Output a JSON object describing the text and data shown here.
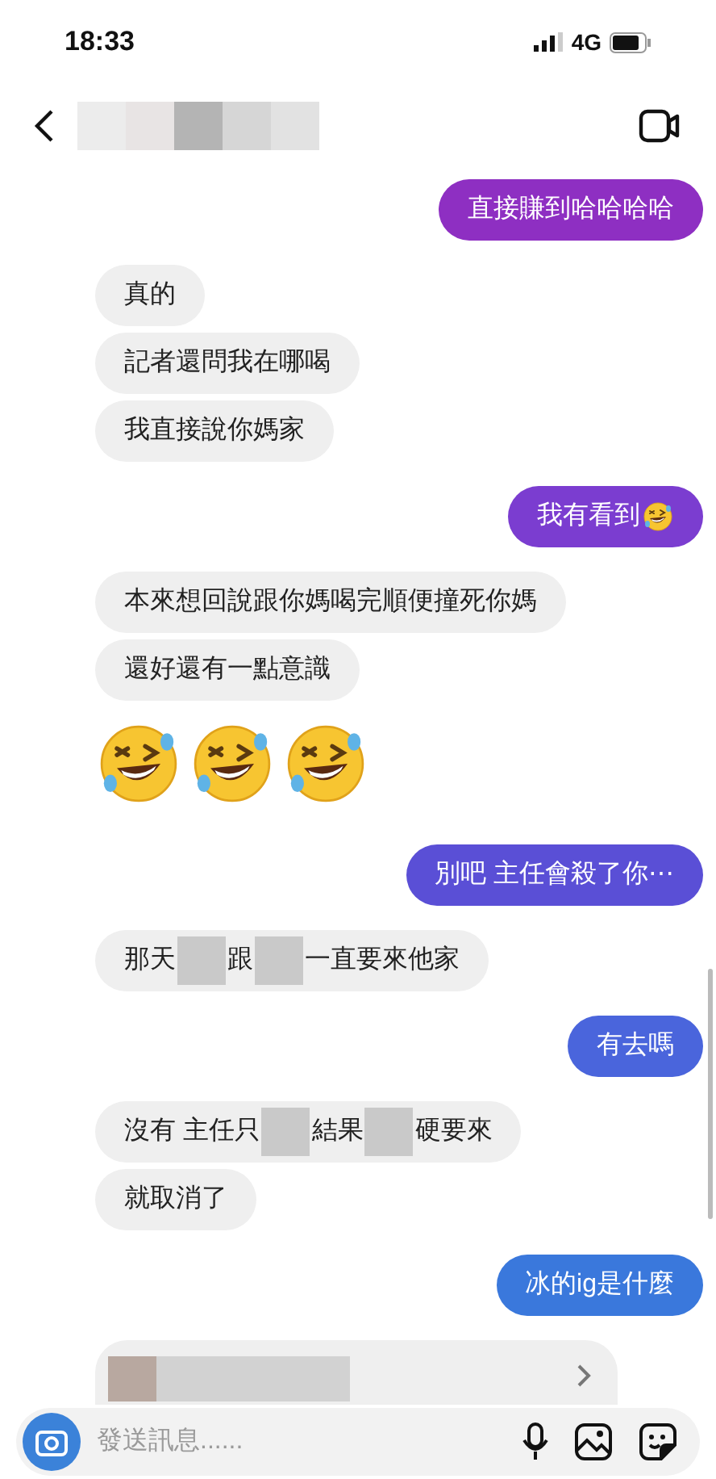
{
  "status_bar": {
    "time": "18:33",
    "network": "4G"
  },
  "messages": [
    {
      "outgoing": true,
      "kind": "text",
      "color": "#8e2fc2",
      "parts": [
        {
          "kind": "text",
          "text": "直接賺到哈哈哈哈"
        }
      ]
    },
    {
      "outgoing": false,
      "kind": "text",
      "parts": [
        {
          "kind": "text",
          "text": "真的"
        }
      ]
    },
    {
      "outgoing": false,
      "kind": "text",
      "parts": [
        {
          "kind": "text",
          "text": "記者還問我在哪喝"
        }
      ]
    },
    {
      "outgoing": false,
      "kind": "text",
      "parts": [
        {
          "kind": "text",
          "text": "我直接說你媽家"
        }
      ]
    },
    {
      "outgoing": true,
      "kind": "text",
      "color": "#7b3dd0",
      "parts": [
        {
          "kind": "text",
          "text": "我有看到"
        },
        {
          "kind": "emoji"
        }
      ]
    },
    {
      "outgoing": false,
      "kind": "text",
      "parts": [
        {
          "kind": "text",
          "text": "本來想回說跟你媽喝完順便撞死你媽"
        }
      ]
    },
    {
      "outgoing": false,
      "kind": "text",
      "parts": [
        {
          "kind": "text",
          "text": "還好還有一點意識"
        }
      ]
    },
    {
      "outgoing": false,
      "kind": "emoji_row",
      "parts": [
        {
          "kind": "emoji"
        },
        {
          "kind": "emoji"
        },
        {
          "kind": "emoji"
        }
      ]
    },
    {
      "outgoing": true,
      "kind": "text",
      "color": "#5a4fd6",
      "parts": [
        {
          "kind": "text",
          "text": "別吧 主任會殺了你⋯"
        }
      ]
    },
    {
      "outgoing": false,
      "kind": "text",
      "parts": [
        {
          "kind": "text",
          "text": "那天"
        },
        {
          "kind": "redacted"
        },
        {
          "kind": "text",
          "text": "跟"
        },
        {
          "kind": "redacted"
        },
        {
          "kind": "text",
          "text": "一直要來他家"
        }
      ]
    },
    {
      "outgoing": true,
      "kind": "text",
      "color": "#4a65dc",
      "parts": [
        {
          "kind": "text",
          "text": "有去嗎"
        }
      ]
    },
    {
      "outgoing": false,
      "kind": "text",
      "parts": [
        {
          "kind": "text",
          "text": "沒有 主任只"
        },
        {
          "kind": "redacted"
        },
        {
          "kind": "text",
          "text": "結果"
        },
        {
          "kind": "redacted"
        },
        {
          "kind": "text",
          "text": "硬要來"
        }
      ]
    },
    {
      "outgoing": false,
      "kind": "text",
      "parts": [
        {
          "kind": "text",
          "text": "就取消了"
        }
      ]
    },
    {
      "outgoing": true,
      "kind": "text",
      "color": "#3a78dc",
      "parts": [
        {
          "kind": "text",
          "text": "冰的ig是什麼"
        }
      ]
    },
    {
      "outgoing": false,
      "kind": "link_card",
      "parts": [
        {
          "kind": "redacted"
        }
      ]
    }
  ],
  "composer": {
    "placeholder": "發送訊息......"
  }
}
